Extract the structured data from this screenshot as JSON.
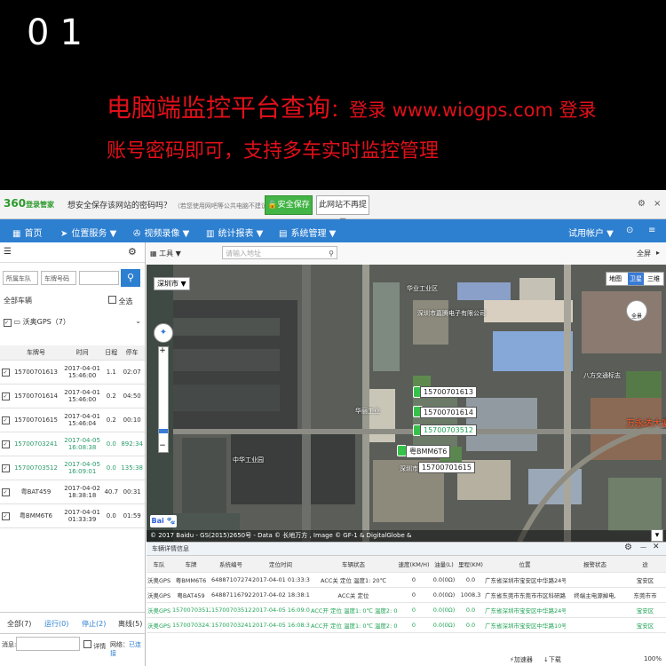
{
  "banner": {
    "number": "01",
    "line1_main": "电脑端监控平台查询",
    "line1_tail": "：登录 www.wiogps.com 登录",
    "line2": "账号密码即可，支持多车实时监控管理"
  },
  "password_bar": {
    "logo": "360",
    "logo_sub": "登录管家",
    "question": "想安全保存该网站的密码吗？",
    "hint": "（若您使用网吧等公共电脑不建议保存）",
    "save_button": "安全保存",
    "never_button": "此网站不再提示",
    "gear": "⚙",
    "close": "×"
  },
  "nav": {
    "items": [
      "首页",
      "位置服务 ▼",
      "视频录像 ▼",
      "统计报表 ▼",
      "系统管理 ▼"
    ],
    "trial_account": "试用帐户 ▼"
  },
  "left_panel": {
    "fleet_select": "所属车队",
    "plate_select": "车牌号码",
    "all_vehicles": "全部车辆",
    "select_all": "全选",
    "group": "沃奥GPS（7）",
    "columns": [
      "车牌号",
      "时间",
      "日程",
      "停车"
    ],
    "rows": [
      {
        "plate": "15700701613",
        "date": "2017-04-01",
        "time": "15:46:00",
        "mileage": "1.1",
        "stop": "02:07",
        "green": false
      },
      {
        "plate": "15700701614",
        "date": "2017-04-01",
        "time": "15:46:00",
        "mileage": "0.2",
        "stop": "04:50",
        "green": false
      },
      {
        "plate": "15700701615",
        "date": "2017-04-01",
        "time": "15:46:04",
        "mileage": "0.2",
        "stop": "00:10",
        "green": false
      },
      {
        "plate": "15700703241",
        "date": "2017-04-05",
        "time": "16:08:38",
        "mileage": "0.0",
        "stop": "892:34",
        "green": true
      },
      {
        "plate": "15700703512",
        "date": "2017-04-05",
        "time": "16:09:01",
        "mileage": "0.0",
        "stop": "135:38",
        "green": true
      },
      {
        "plate": "粤BAT459",
        "date": "2017-04-02",
        "time": "18:38:18",
        "mileage": "40.7",
        "stop": "00:31",
        "green": false
      },
      {
        "plate": "粤BMM6T6",
        "date": "2017-04-01",
        "time": "01:33:39",
        "mileage": "0.0",
        "stop": "01:59",
        "green": false
      }
    ],
    "filters": [
      "全部(7)",
      "运行(0)",
      "停止(2)",
      "离线(5)"
    ],
    "message_label": "消息:",
    "detail_label": "详情",
    "network_label": "网络：",
    "network_status": "已连接"
  },
  "map": {
    "tool_label": "工具 ▼",
    "search_placeholder": "请输入地址",
    "fullscreen": "全屏",
    "city": "深圳市",
    "layers": [
      "地图",
      "卫星",
      "三维"
    ],
    "full_view": "全景",
    "copyright": "© 2017 Baidu - GS(2015)2650号 - Data © 长地万方 , Image © GF-1 & DigitalGlobe &",
    "labels": [
      {
        "text": "15700701613",
        "green": false
      },
      {
        "text": "15700701614",
        "green": false
      },
      {
        "text": "15700703512",
        "green": true
      },
      {
        "text": "粤BMM6T6",
        "green": false
      },
      {
        "text": "15700701615",
        "green": false
      }
    ],
    "pois": [
      "华业工业区",
      "深圳市嘉腾电子有限公司",
      "八方交通标志",
      "万永达大厦",
      "中华工业园",
      "华丽工业",
      "深圳市国兴电子有限公司"
    ]
  },
  "detail_panel": {
    "title": "车辆详情信息",
    "columns": [
      "车队",
      "车牌",
      "系统编号",
      "定位时间",
      "车辆状态",
      "速度(KM/H)",
      "油量(L)",
      "里程(KM)",
      "位置",
      "报警状态",
      "途"
    ],
    "rows": [
      {
        "fleet": "沃奥GPS",
        "plate": "粤BMM6T6",
        "sysno": "64887107274",
        "time": "2017-04-01 01:33:39",
        "status": "ACC关 定位 温度1: 20℃",
        "speed": "0",
        "oil": "0.0(0Ω)",
        "mileage": "0.0",
        "location": "广东省深圳市宝安区中华路24号",
        "alarm": "",
        "route": "宝安区",
        "green": false
      },
      {
        "fleet": "沃奥GPS",
        "plate": "粤BAT459",
        "sysno": "64887116792",
        "time": "2017-04-02 18:38:18",
        "status": "ACC关 定位",
        "speed": "0",
        "oil": "0.0(0Ω)",
        "mileage": "1008.3",
        "location": "广东省东莞市东莞市市区科研路",
        "alarm": "终端主电源掉电,",
        "route": "东莞市市",
        "green": false
      },
      {
        "fleet": "沃奥GPS",
        "plate": "15700703512",
        "sysno": "15700703512",
        "time": "2017-04-05 16:09:01",
        "status": "ACC开 定位 温度1: 0℃ 温度2: 0℃",
        "speed": "0",
        "oil": "0.0(0Ω)",
        "mileage": "0.0",
        "location": "广东省深圳市宝安区中华路24号",
        "alarm": "",
        "route": "宝安区",
        "green": true
      },
      {
        "fleet": "沃奥GPS",
        "plate": "15700703241",
        "sysno": "15700703241",
        "time": "2017-04-05 16:08:38",
        "status": "ACC开 定位 温度1: 0℃ 温度2: 0℃",
        "speed": "0",
        "oil": "0.0(0Ω)",
        "mileage": "0.0",
        "location": "广东省深圳市宝安区中华路10号",
        "alarm": "",
        "route": "宝安区",
        "green": true
      }
    ]
  },
  "taskbar": {
    "accelerator": "加速器",
    "download": "下载",
    "zoom": "100%"
  }
}
